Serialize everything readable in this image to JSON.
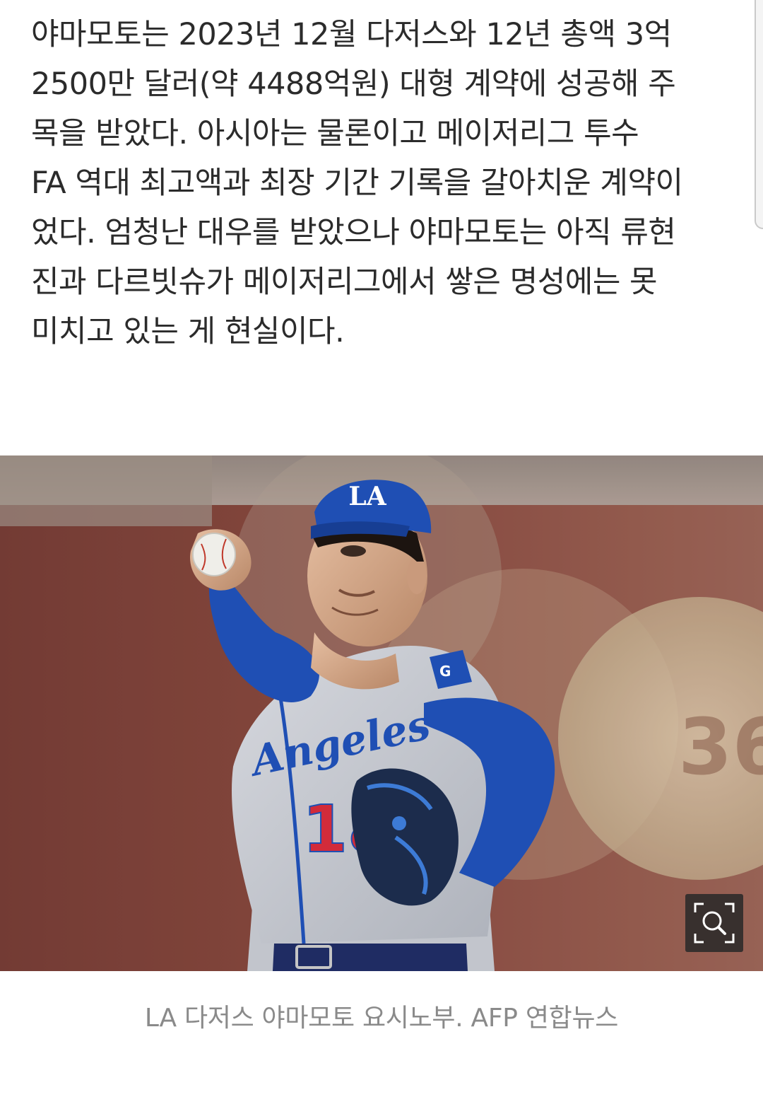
{
  "article": {
    "paragraph_lines": [
      "야마모토는 2023년 12월 다저스와 12년 총액 3억",
      "2500만 달러(약 4488억원) 대형 계약에 성공해 주",
      "목을 받았다. 아시아는 물론이고 메이저리그 투수",
      "FA 역대 최고액과 최장 기간 기록을 갈아치운 계약이",
      "었다. 엄청난 대우를 받았으나 야마모토는 아직 류현",
      "진과 다르빗슈가 메이저리그에서 쌓은 명성에는 못",
      "미치고 있는 게 현실이다."
    ]
  },
  "photo": {
    "cap_logo": "LA",
    "jersey_script": "Angeles",
    "jersey_number": "18",
    "zoom_icon": "zoom-magnifier-icon",
    "colors": {
      "dodger_blue": "#1f4fb4",
      "jersey_gray": "#c9ccd3",
      "number_red": "#d22b3a",
      "background_brick": "#8a4a40"
    }
  },
  "caption": {
    "text": "LA 다저스 야마모토 요시노부. AFP 연합뉴스"
  }
}
